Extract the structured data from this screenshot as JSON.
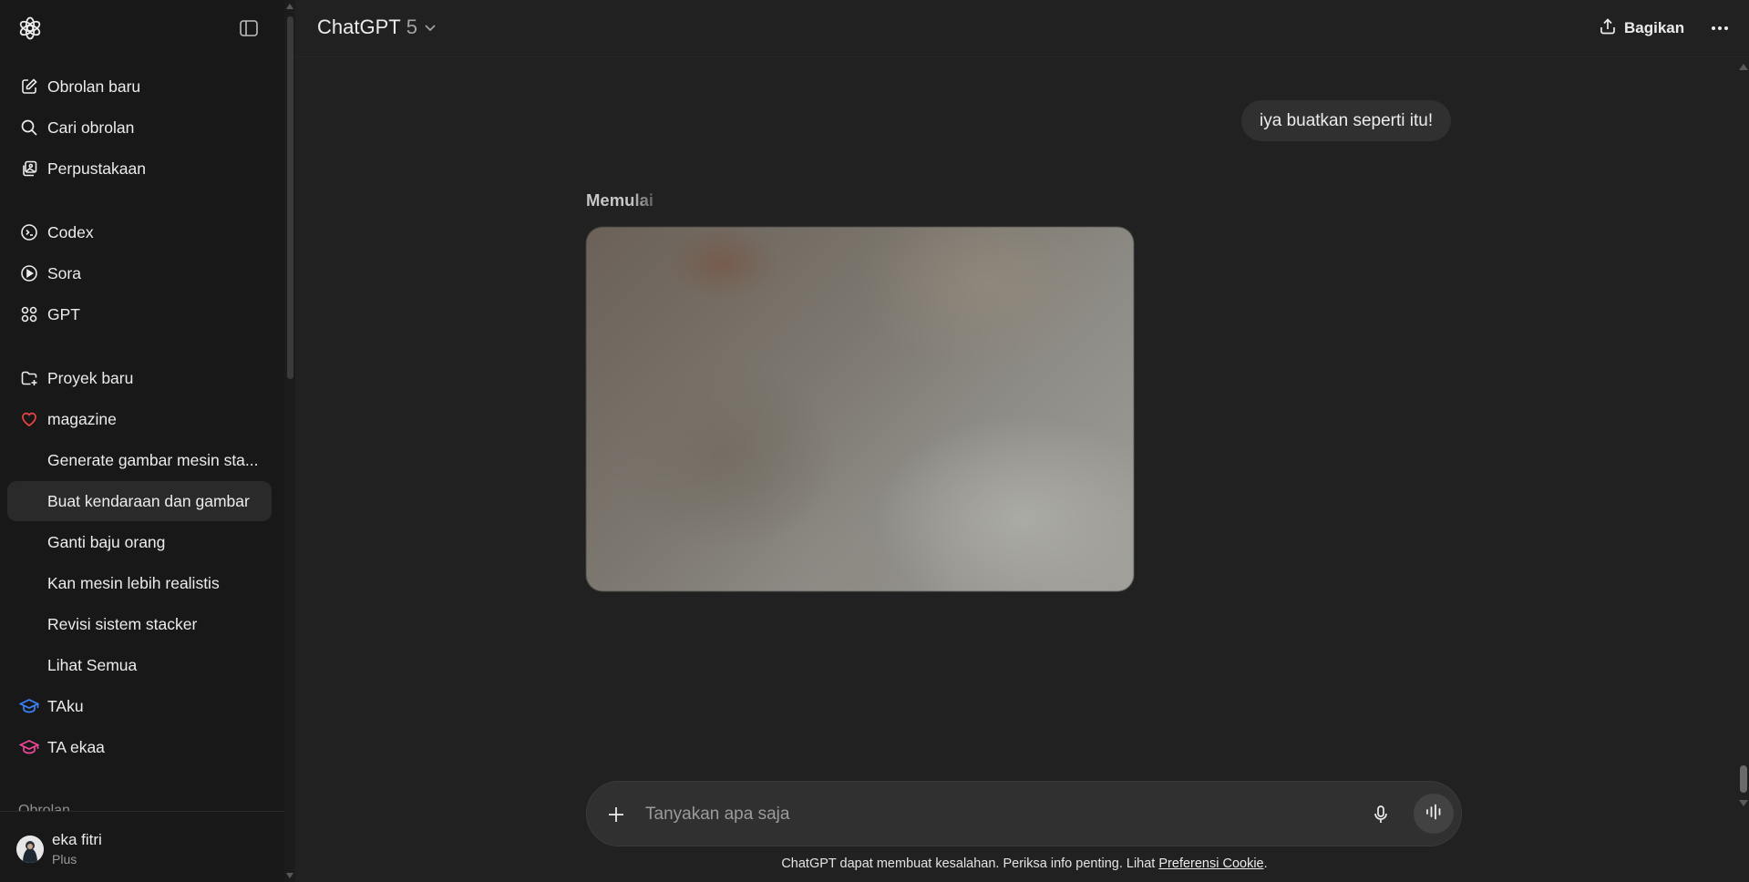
{
  "sidebar": {
    "nav": [
      {
        "label": "Obrolan baru",
        "icon": "new-chat-icon"
      },
      {
        "label": "Cari obrolan",
        "icon": "search-icon"
      },
      {
        "label": "Perpustakaan",
        "icon": "library-icon"
      },
      {
        "label": "Codex",
        "icon": "codex-icon"
      },
      {
        "label": "Sora",
        "icon": "play-circle-icon"
      },
      {
        "label": "GPT",
        "icon": "grid-icon"
      }
    ],
    "projects": [
      {
        "label": "Proyek baru",
        "icon": "folder-plus-icon"
      },
      {
        "label": "magazine",
        "icon": "heart-icon",
        "color": "#ef4444"
      },
      {
        "label": "Generate gambar mesin sta..."
      },
      {
        "label": "Buat kendaraan dan gambar",
        "active": true
      },
      {
        "label": "Ganti baju orang"
      },
      {
        "label": "Kan mesin lebih realistis"
      },
      {
        "label": "Revisi sistem stacker"
      },
      {
        "label": "Lihat Semua"
      },
      {
        "label": "TAku",
        "icon": "graduation-cap-icon",
        "color": "#3b82f6"
      },
      {
        "label": "TA ekaa",
        "icon": "graduation-cap-icon",
        "color": "#ec4899"
      }
    ],
    "section_label": "Obrolan",
    "user": {
      "name": "eka fitri",
      "plan": "Plus"
    }
  },
  "header": {
    "model_name": "ChatGPT",
    "model_version": "5",
    "share_label": "Bagikan"
  },
  "conversation": {
    "user_message": "iya buatkan seperti itu!",
    "status": "Memulai"
  },
  "composer": {
    "placeholder": "Tanyakan apa saja",
    "value": ""
  },
  "footer": {
    "disclaimer_text": "ChatGPT dapat membuat kesalahan. Periksa info penting. Lihat ",
    "cookie_link": "Preferensi Cookie",
    "disclaimer_end": "."
  },
  "colors": {
    "background": "#212121",
    "sidebar": "#181818",
    "magazine_icon": "#ef4444",
    "taku_icon": "#3b82f6",
    "taekaa_icon": "#ec4899"
  }
}
